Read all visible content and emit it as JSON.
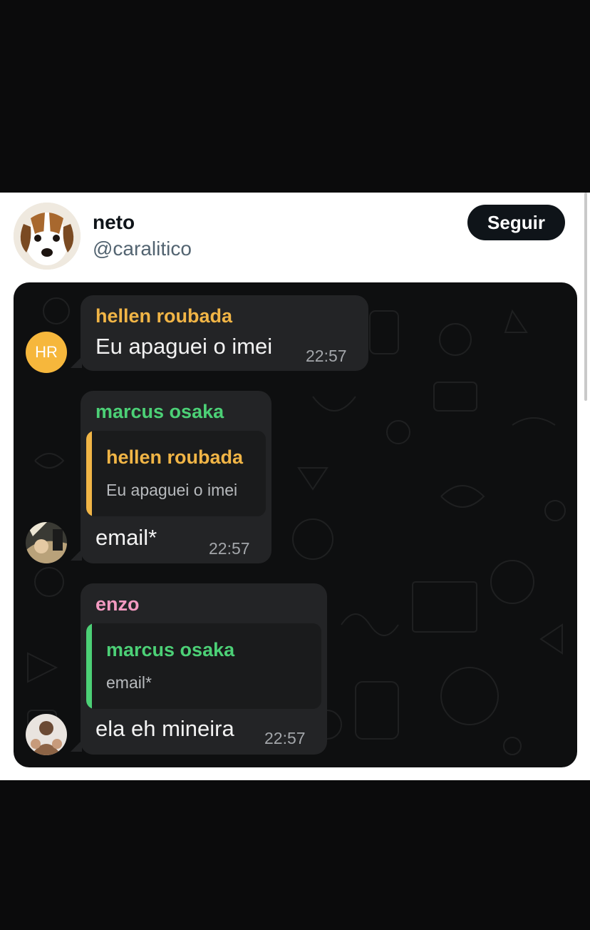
{
  "post": {
    "author_name": "neto",
    "author_handle": "@caralitico",
    "follow_label": "Seguir"
  },
  "chat": {
    "messages": [
      {
        "sender": "hellen roubada",
        "sender_color": "#f1b546",
        "text": "Eu apaguei o imei",
        "time": "22:57",
        "avatar_initials": "HR"
      },
      {
        "sender": "marcus osaka",
        "sender_color": "#4cd076",
        "quote_sender": "hellen roubada",
        "quote_text": "Eu apaguei o imei",
        "text": "email*",
        "time": "22:57"
      },
      {
        "sender": "enzo",
        "sender_color": "#f39ac1",
        "quote_sender": "marcus osaka",
        "quote_text": "email*",
        "text": "ela eh mineira",
        "time": "22:57"
      }
    ]
  }
}
